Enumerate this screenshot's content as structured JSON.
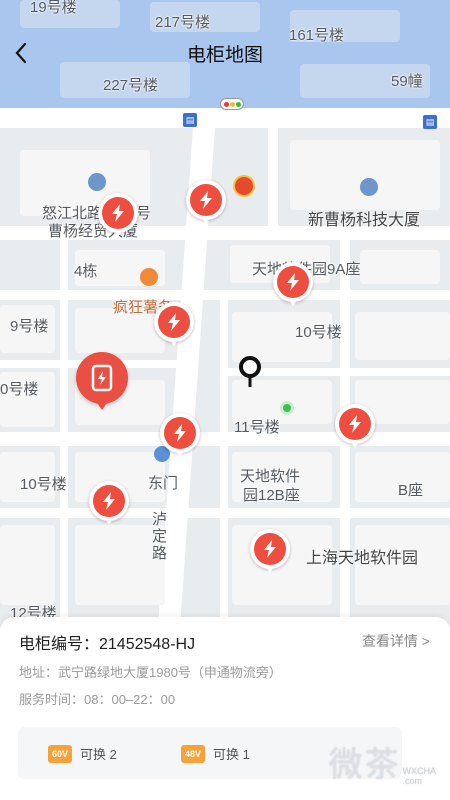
{
  "header": {
    "title": "电柜地图",
    "back_icon": "chevron-left-icon"
  },
  "map": {
    "labels": [
      {
        "text": "19号楼"
      },
      {
        "text": "217号楼"
      },
      {
        "text": "161号楼"
      },
      {
        "text": "227号楼"
      },
      {
        "text": "59幢"
      },
      {
        "text": "怒江北路"
      },
      {
        "text": "号"
      },
      {
        "text": "曹杨经贸大厦"
      },
      {
        "text": "新曹杨科技大厦"
      },
      {
        "text": "4栋"
      },
      {
        "text": "天地软件园9A座"
      },
      {
        "text": "疯狂薯条"
      },
      {
        "text": "9号楼"
      },
      {
        "text": "10号楼"
      },
      {
        "text": "0号楼"
      },
      {
        "text": "11号楼"
      },
      {
        "text": "10号楼"
      },
      {
        "text": "东门"
      },
      {
        "text": "天地软件"
      },
      {
        "text": "园12B座"
      },
      {
        "text": "B座"
      },
      {
        "text": "泸"
      },
      {
        "text": "定"
      },
      {
        "text": "路"
      },
      {
        "text": "上海天地软件园"
      },
      {
        "text": "12号楼"
      }
    ],
    "colors": {
      "water": "#a9c6ee",
      "pin": "#ee4e40",
      "accent": "#f5a23a"
    }
  },
  "cabinet": {
    "number_label": "电柜编号：21452548-HJ",
    "detail_link": "查看详情 >",
    "address": "地址：武宁路绿地大厦1980号（申通物流旁）",
    "hours": "服务时间：08：00–22：00",
    "availability": [
      {
        "badge": "60V",
        "label": "可换 2"
      },
      {
        "badge": "48V",
        "label": "可换 1"
      }
    ]
  },
  "watermark": {
    "text": "微茶",
    "small_top": "WXCHA",
    "small_bottom": ".com"
  }
}
